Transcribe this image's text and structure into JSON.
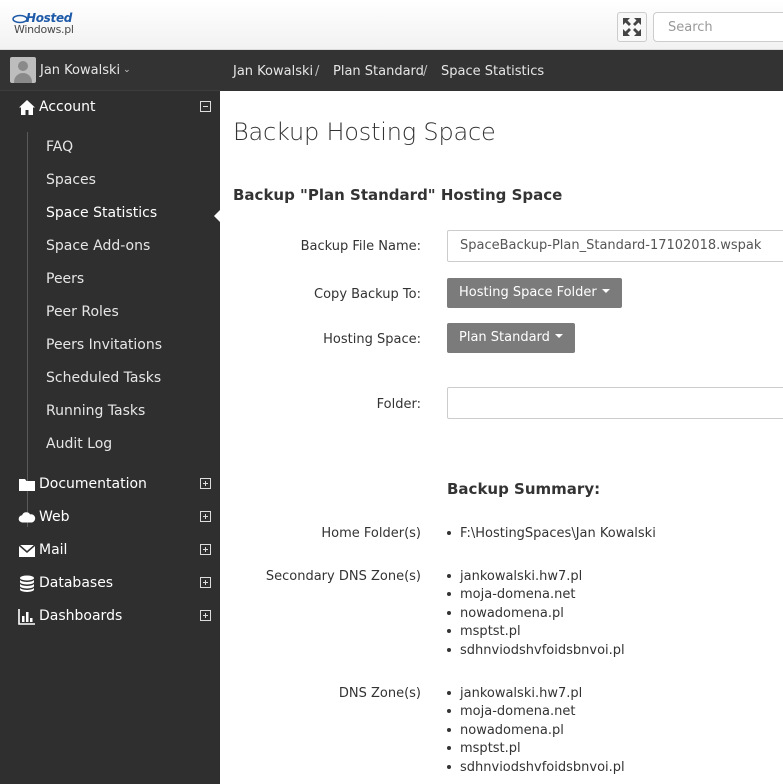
{
  "header": {
    "logo_line1": "Hosted",
    "logo_line2": "Windows.pl",
    "search_placeholder": "Search"
  },
  "sidebar": {
    "user_name": "Jan Kowalski",
    "account": {
      "label": "Account",
      "items": [
        "FAQ",
        "Spaces",
        "Space Statistics",
        "Space Add-ons",
        "Peers",
        "Peer Roles",
        "Peers Invitations",
        "Scheduled Tasks",
        "Running Tasks",
        "Audit Log"
      ],
      "active_item": "Space Statistics"
    },
    "groups": [
      {
        "label": "Documentation",
        "icon": "folder-icon"
      },
      {
        "label": "Web",
        "icon": "cloud-icon"
      },
      {
        "label": "Mail",
        "icon": "envelope-icon"
      },
      {
        "label": "Databases",
        "icon": "database-icon"
      },
      {
        "label": "Dashboards",
        "icon": "bar-chart-icon"
      }
    ]
  },
  "breadcrumb": [
    "Jan Kowalski",
    "Plan Standard",
    "Space Statistics"
  ],
  "main": {
    "page_title": "Backup Hosting Space",
    "section_title": "Backup \"Plan Standard\" Hosting Space",
    "form": {
      "backup_file_name_label": "Backup File Name:",
      "backup_file_name_value": "SpaceBackup-Plan_Standard-17102018.wspak",
      "copy_backup_to_label": "Copy Backup To:",
      "copy_backup_to_value": "Hosting Space Folder",
      "hosting_space_label": "Hosting Space:",
      "hosting_space_value": "Plan Standard",
      "folder_label": "Folder:",
      "folder_value": ""
    },
    "summary": {
      "title": "Backup Summary:",
      "home_folder_label": "Home Folder(s)",
      "home_folders": [
        "F:\\HostingSpaces\\Jan Kowalski"
      ],
      "secondary_dns_label": "Secondary DNS Zone(s)",
      "secondary_dns_zones": [
        "jankowalski.hw7.pl",
        "moja-domena.net",
        "nowadomena.pl",
        "msptst.pl",
        "sdhnviodshvfoidsbnvoi.pl"
      ],
      "dns_label": "DNS Zone(s)",
      "dns_zones": [
        "jankowalski.hw7.pl",
        "moja-domena.net",
        "nowadomena.pl",
        "msptst.pl",
        "sdhnviodshvfoidsbnvoi.pl"
      ]
    }
  }
}
